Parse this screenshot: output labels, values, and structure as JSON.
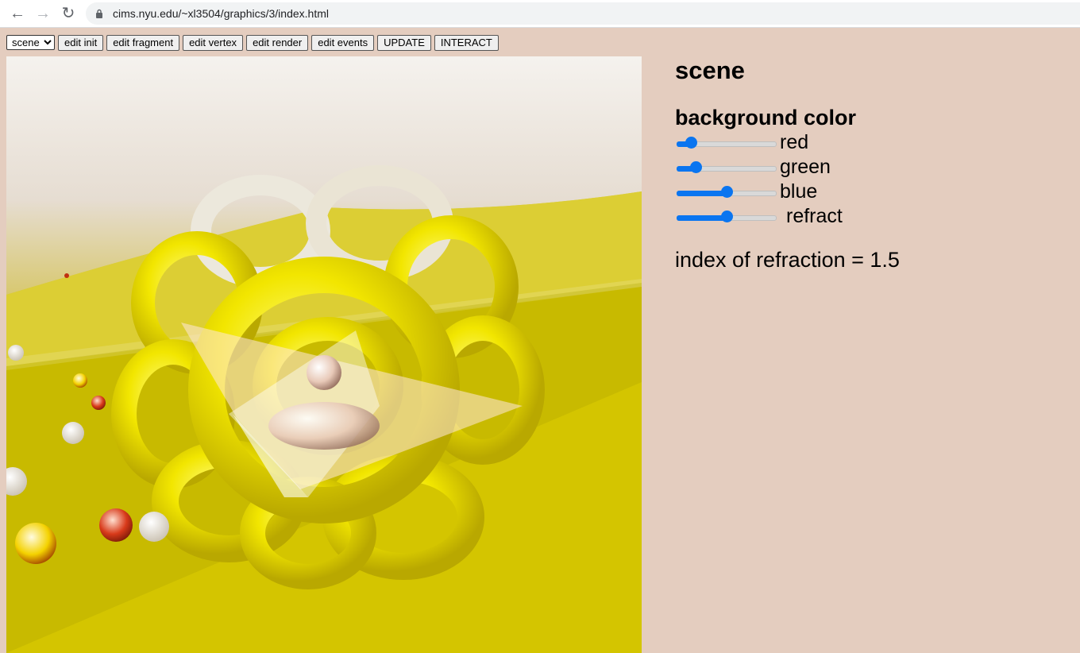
{
  "browser": {
    "url": "cims.nyu.edu/~xl3504/graphics/3/index.html"
  },
  "toolbar": {
    "scene_select": {
      "selected": "scene"
    },
    "buttons": [
      "edit init",
      "edit fragment",
      "edit vertex",
      "edit render",
      "edit events",
      "UPDATE",
      "INTERACT"
    ]
  },
  "panel": {
    "title": "scene",
    "bg_heading": "background color",
    "sliders": [
      {
        "label": "red",
        "value": 0.1
      },
      {
        "label": "green",
        "value": 0.15
      },
      {
        "label": "blue",
        "value": 0.5
      },
      {
        "label": "refract",
        "value": 0.5
      }
    ],
    "ior_text": "index of refraction = 1.5"
  },
  "colors": {
    "accent": "#0a75f0",
    "page_bg": "#e4cdbf",
    "scene_floor": "#d4c500",
    "torus_yellow": "#f2e600"
  }
}
